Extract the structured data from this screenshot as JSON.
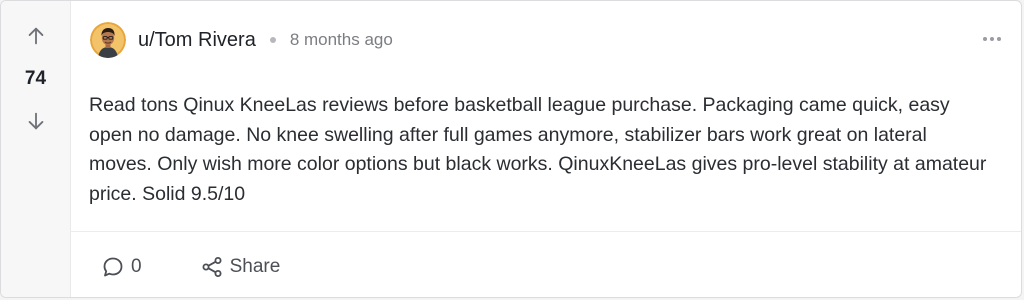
{
  "post": {
    "score": "74",
    "author": "u/Tom Rivera",
    "timestamp": "8 months ago",
    "body": "Read tons Qinux KneeLas reviews before basketball league purchase. Packaging came quick, easy open no damage. No knee swelling after full games anymore, stabilizer bars work great on lateral moves. Only wish more color options but black works. QinuxKneeLas gives pro-level stability at amateur price. Solid 9.5/10",
    "comment_count": "0",
    "share_label": "Share"
  },
  "icons": {
    "upvote": "arrow-up-icon",
    "downvote": "arrow-down-icon",
    "more": "more-horizontal-icon",
    "comment": "comment-bubble-icon",
    "share": "share-icon"
  },
  "colors": {
    "rail_bg": "#f7f7f8",
    "text": "#1f2329",
    "muted": "#7b7d82",
    "icon": "#4c4f55"
  }
}
